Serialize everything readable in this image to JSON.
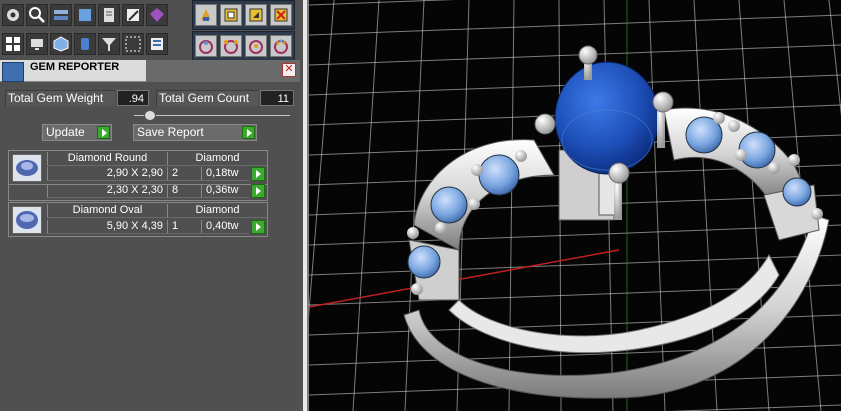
{
  "gem_reporter": {
    "title": "GEM REPORTER",
    "close_icon": "close-icon",
    "total_weight_label": "Total Gem Weight",
    "total_weight_value": ".94",
    "total_count_label": "Total Gem Count",
    "total_count_value": "11",
    "update_label": "Update",
    "save_report_label": "Save Report",
    "groups": [
      {
        "name": "Diamond Round",
        "material": "Diamond",
        "rows": [
          {
            "size": "2,90 X 2,90",
            "count": "2",
            "weight": "0,18tw"
          },
          {
            "size": "2,30 X 2,30",
            "count": "8",
            "weight": "0,36tw"
          }
        ]
      },
      {
        "name": "Diamond Oval",
        "material": "Diamond",
        "rows": [
          {
            "size": "5,90 X 4,39",
            "count": "1",
            "weight": "0,40tw"
          }
        ]
      }
    ]
  },
  "toolbar": {
    "row1": [
      "settings-icon",
      "search-icon",
      "layers-icon",
      "box-icon",
      "document-icon",
      "edit-icon",
      "gem-icon"
    ],
    "row2": [
      "grid-icon",
      "monitor-icon",
      "cube-icon",
      "cylinder-icon",
      "filter-icon",
      "selection-icon",
      "list-icon"
    ],
    "group_row1": [
      "paint-icon",
      "import-icon",
      "export-icon",
      "move-icon"
    ],
    "group_row2": [
      "gem-setting-icon",
      "prong-icon",
      "bezel-icon",
      "pave-icon"
    ]
  },
  "colors": {
    "panel_bg": "#505050",
    "accent_green": "#3caa2e",
    "grid_white": "#e0e0e0",
    "axis_red": "#c02020",
    "gem_blue": "#1d4fb8",
    "small_gem": "#7aa6e0"
  }
}
